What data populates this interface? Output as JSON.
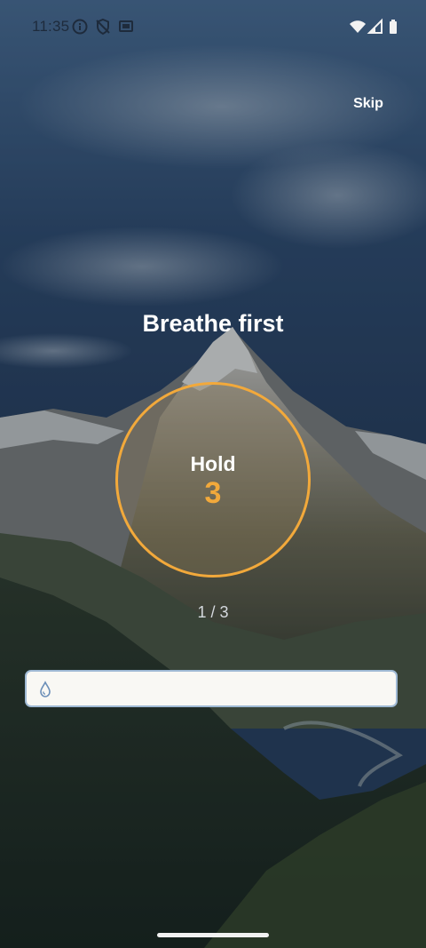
{
  "status_bar": {
    "time": "11:35",
    "left_icons": [
      "info-icon",
      "shield-off-icon",
      "cast-icon"
    ],
    "right_icons": [
      "wifi-icon",
      "signal-icon",
      "battery-icon"
    ]
  },
  "header": {
    "skip_label": "Skip"
  },
  "exercise": {
    "title": "Breathe first",
    "phase": "Hold",
    "count": "3",
    "progress": "1 / 3"
  },
  "input": {
    "icon": "water-drop-icon",
    "value": "",
    "placeholder": ""
  },
  "colors": {
    "accent": "#f2a93b",
    "input_border": "#9fb9d4",
    "input_bg": "#f9f8f4"
  }
}
